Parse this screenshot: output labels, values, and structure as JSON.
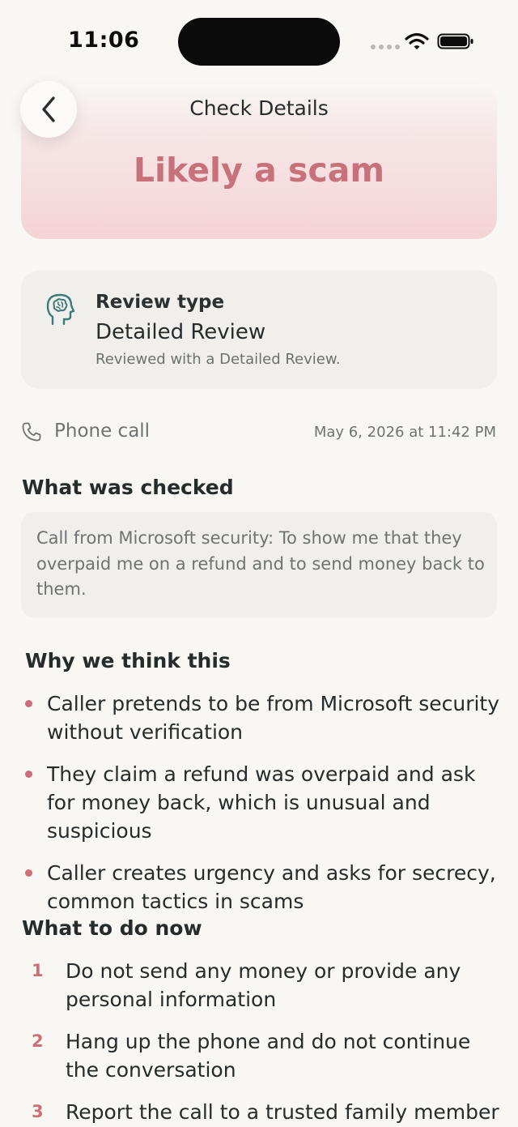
{
  "status_bar": {
    "time": "11:06"
  },
  "header": {
    "title": "Check Details",
    "back_icon": "chevron-left-icon"
  },
  "result": {
    "label": "Likely a scam",
    "color": "#c7717b"
  },
  "review": {
    "heading": "Review type",
    "value": "Detailed Review",
    "description": "Reviewed with a Detailed Review.",
    "icon": "brain-head-icon"
  },
  "meta": {
    "source": "Phone call",
    "source_icon": "phone-icon",
    "date": "May 6, 2026 at 11:42 PM"
  },
  "checked": {
    "title": "What was checked",
    "text": "Call from Microsoft security: To show me that they overpaid me on a refund and to send money back to them."
  },
  "reasons": {
    "title": "Why we think this",
    "items": [
      "Caller pretends to be from Microsoft security without verification",
      "They claim a refund was overpaid and ask for money back, which is unusual and suspicious",
      "Caller creates urgency and asks for secrecy, common tactics in scams"
    ]
  },
  "steps": {
    "title": "What to do now",
    "items": [
      {
        "number": "1",
        "text": "Do not send any money or provide any personal information"
      },
      {
        "number": "2",
        "text": "Hang up the phone and do not continue the conversation"
      },
      {
        "number": "3",
        "text": "Report the call to a trusted family member"
      }
    ]
  },
  "colors": {
    "accent": "#cd6e78",
    "background": "#f8f7f4",
    "card": "#f0efec"
  }
}
